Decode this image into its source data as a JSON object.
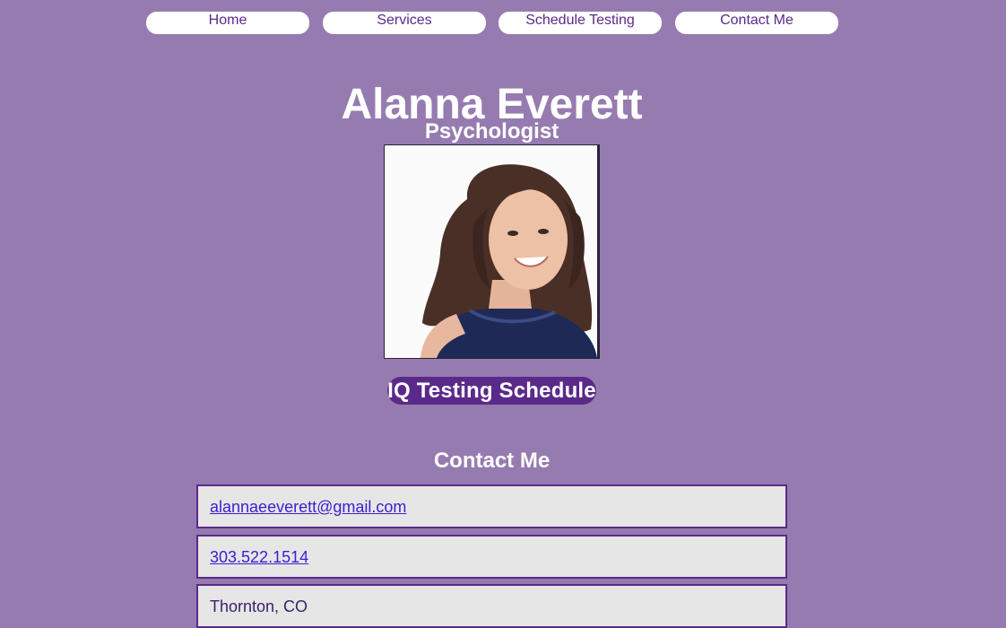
{
  "nav": {
    "items": [
      {
        "label": "Home"
      },
      {
        "label": "Services"
      },
      {
        "label": "Schedule Testing"
      },
      {
        "label": "Contact Me"
      }
    ]
  },
  "header": {
    "name": "Alanna Everett",
    "role": "Psychologist"
  },
  "profile_photo": {
    "icon": "portrait-photo"
  },
  "cta": {
    "label": "IQ Testing Schedule"
  },
  "contact": {
    "title": "Contact Me",
    "email": "alannaeeverett@gmail.com",
    "phone": "303.522.1514",
    "location": "Thornton, CO"
  },
  "colors": {
    "background": "#967bb0",
    "accent": "#5a2a8a",
    "card": "#e6e6e6",
    "link": "#3b1fcf"
  }
}
